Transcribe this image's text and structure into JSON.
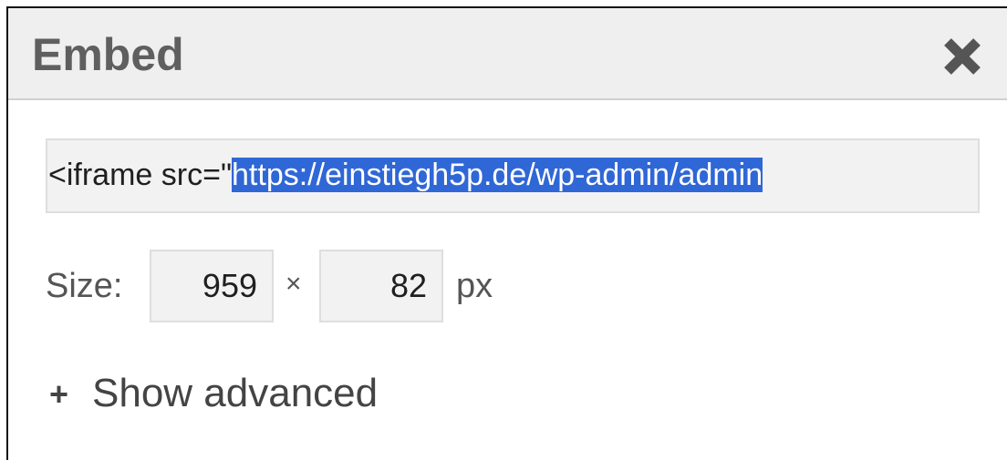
{
  "dialog": {
    "title": "Embed",
    "close_icon": "close-icon"
  },
  "embed": {
    "code_prefix": "<iframe src=\"",
    "code_selected": "https://einstiegh5p.de/wp-admin/admin"
  },
  "size": {
    "label": "Size:",
    "width": "959",
    "separator": "×",
    "height": "82",
    "unit": "px"
  },
  "advanced": {
    "icon": "+",
    "label": "Show advanced"
  },
  "colors": {
    "header_bg": "#efefef",
    "selection": "#3067d6",
    "field_bg": "#f2f2f2"
  }
}
